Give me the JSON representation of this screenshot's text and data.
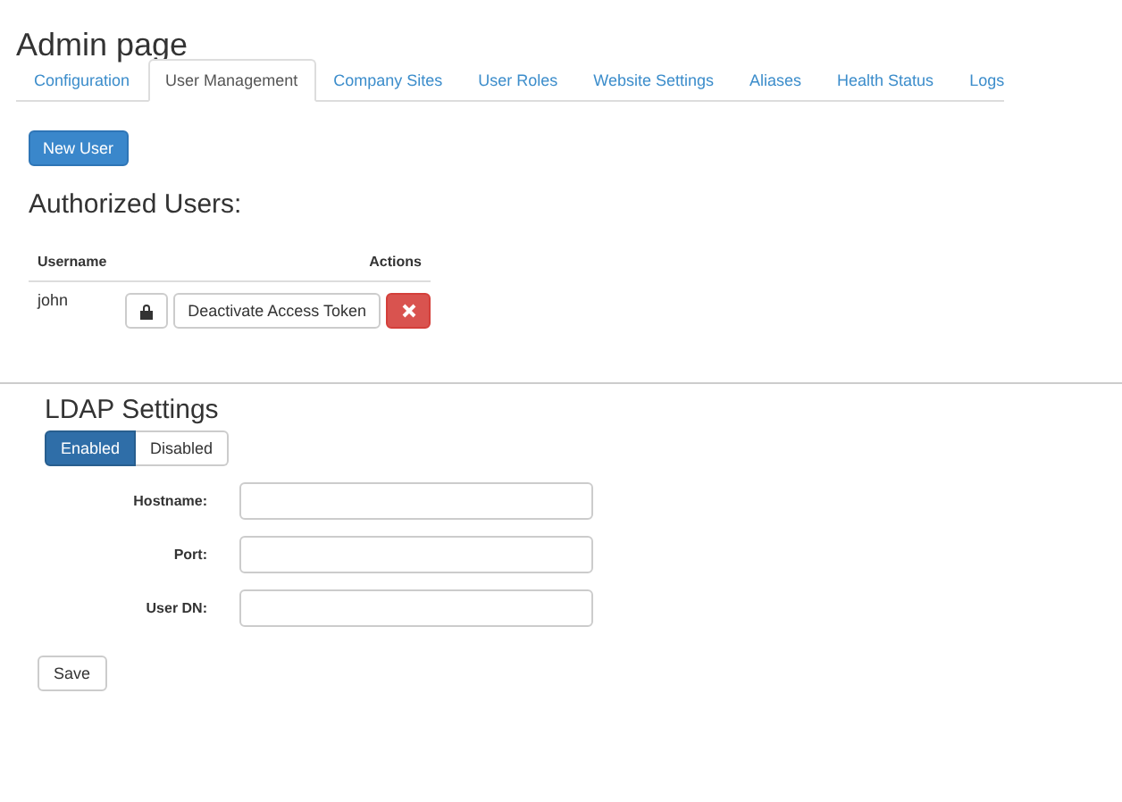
{
  "page_title": "Admin page",
  "tabs": [
    {
      "label": "Configuration",
      "selected": false
    },
    {
      "label": "User Management",
      "selected": true
    },
    {
      "label": "Company Sites",
      "selected": false
    },
    {
      "label": "User Roles",
      "selected": false
    },
    {
      "label": "Website Settings",
      "selected": false
    },
    {
      "label": "Aliases",
      "selected": false
    },
    {
      "label": "Health Status",
      "selected": false
    },
    {
      "label": "Logs",
      "selected": false
    }
  ],
  "new_user_button": "New User",
  "users_heading": "Authorized Users:",
  "table": {
    "columns": [
      "Username",
      "Actions"
    ],
    "rows": [
      {
        "username": "john",
        "deactivate_button": "Deactivate Access Token"
      }
    ]
  },
  "ldap": {
    "heading": "LDAP Settings",
    "toggle": [
      {
        "label": "Enabled",
        "selected": true
      },
      {
        "label": "Disabled",
        "selected": false
      }
    ],
    "fields": [
      {
        "label": "Hostname:"
      },
      {
        "label": "Port:"
      },
      {
        "label": "User DN:"
      }
    ],
    "save_button": "Save"
  }
}
